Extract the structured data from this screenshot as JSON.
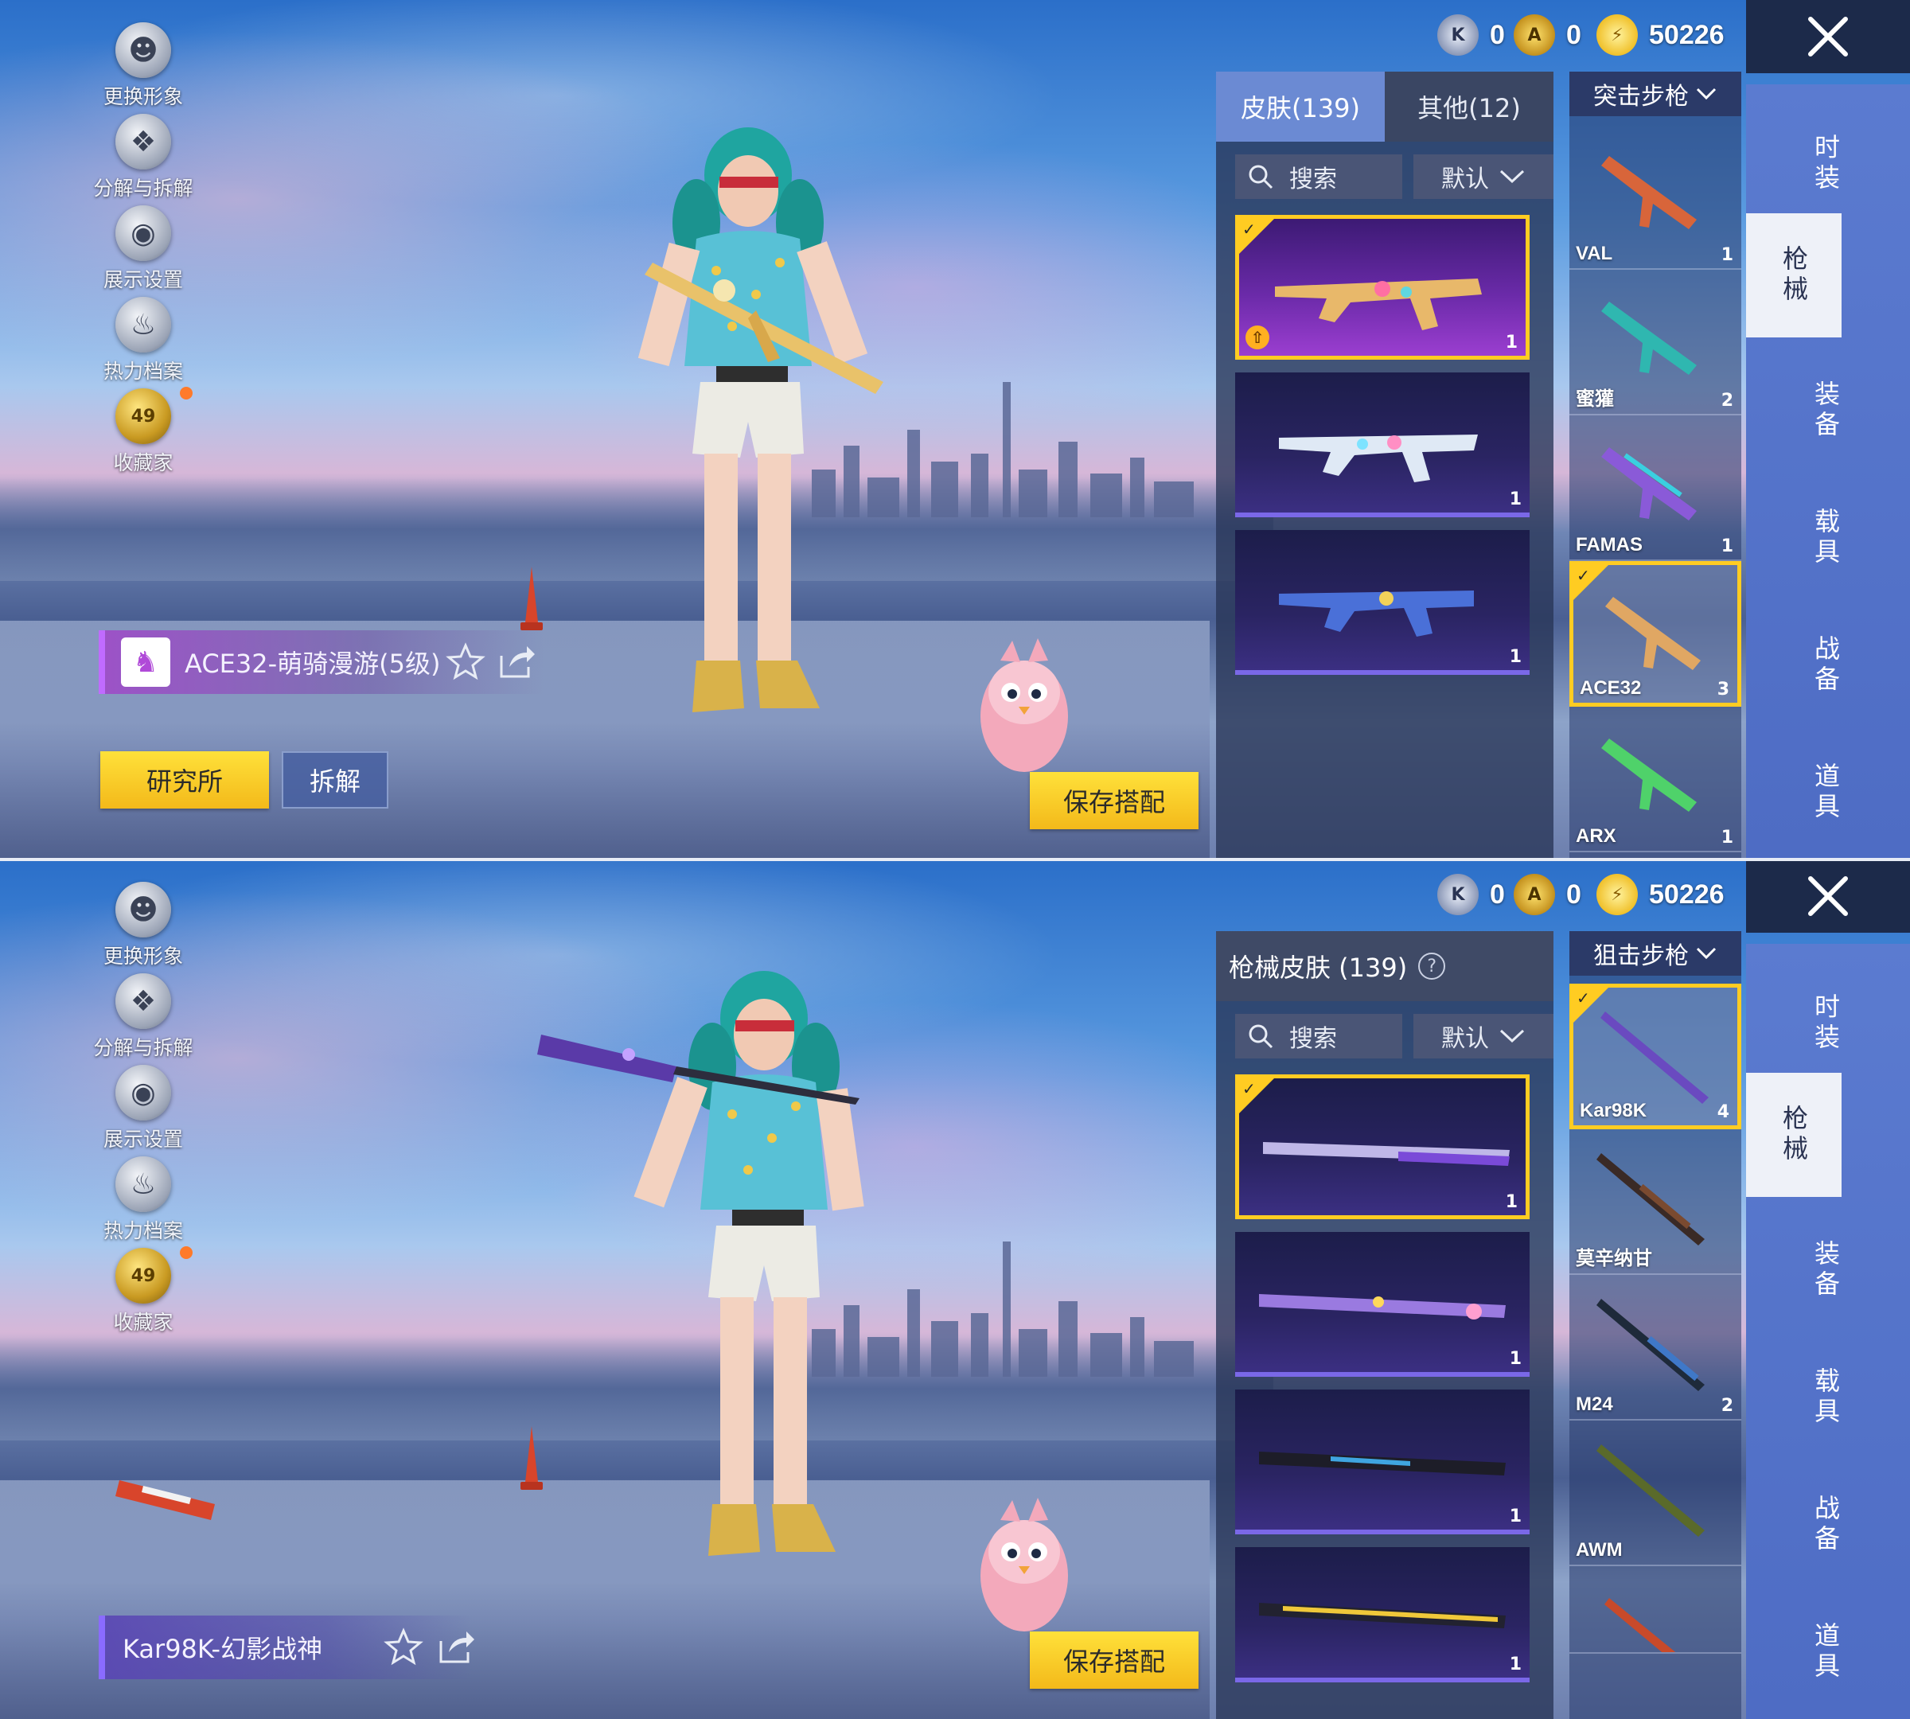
{
  "top": {
    "sidebar": [
      {
        "label": "更换形象"
      },
      {
        "label": "分解与拆解"
      },
      {
        "label": "展示设置"
      },
      {
        "label": "热力档案"
      },
      {
        "label": "收藏家",
        "badge": "49"
      }
    ],
    "currency": [
      {
        "icon": "medal-silver-icon",
        "value": "0"
      },
      {
        "icon": "medal-gold-icon",
        "value": "0"
      },
      {
        "icon": "coin-icon",
        "value": "50226"
      }
    ],
    "tabs": [
      {
        "label": "皮肤(139)",
        "active": true
      },
      {
        "label": "其他(12)",
        "active": false
      }
    ],
    "search_label": "搜索",
    "sort_label": "默认",
    "category": "突击步枪",
    "skins": [
      {
        "count": "1",
        "selected": true
      },
      {
        "count": "1",
        "selected": false
      },
      {
        "count": "1",
        "selected": false
      }
    ],
    "weapons": [
      {
        "name": "VAL",
        "count": "1",
        "selected": false
      },
      {
        "name": "蜜獾",
        "count": "2",
        "selected": false
      },
      {
        "name": "FAMAS",
        "count": "1",
        "selected": false
      },
      {
        "name": "ACE32",
        "count": "3",
        "selected": true
      },
      {
        "name": "ARX",
        "count": "1",
        "selected": false
      }
    ],
    "banner_name": "ACE32-萌骑漫游(5级)",
    "research_button": "研究所",
    "dismantle_button": "拆解",
    "save_button": "保存搭配"
  },
  "bottom": {
    "sidebar": [
      {
        "label": "更换形象"
      },
      {
        "label": "分解与拆解"
      },
      {
        "label": "展示设置"
      },
      {
        "label": "热力档案"
      },
      {
        "label": "收藏家",
        "badge": "49"
      }
    ],
    "currency": [
      {
        "icon": "medal-silver-icon",
        "value": "0"
      },
      {
        "icon": "medal-gold-icon",
        "value": "0"
      },
      {
        "icon": "coin-icon",
        "value": "50226"
      }
    ],
    "panel_title": "枪械皮肤 (139)",
    "search_label": "搜索",
    "sort_label": "默认",
    "category": "狙击步枪",
    "skins": [
      {
        "count": "1",
        "selected": true
      },
      {
        "count": "1",
        "selected": false
      },
      {
        "count": "1",
        "selected": false
      },
      {
        "count": "1",
        "selected": false
      }
    ],
    "weapons": [
      {
        "name": "Kar98K",
        "count": "4",
        "selected": true
      },
      {
        "name": "莫辛纳甘",
        "count": "",
        "selected": false
      },
      {
        "name": "M24",
        "count": "2",
        "selected": false
      },
      {
        "name": "AWM",
        "count": "",
        "selected": false
      },
      {
        "name": "",
        "count": "",
        "selected": false
      }
    ],
    "banner_name": "Kar98K-幻影战神",
    "save_button": "保存搭配"
  },
  "vnav": [
    {
      "label": "时装",
      "active": false
    },
    {
      "label": "枪械",
      "active": true
    },
    {
      "label": "装备",
      "active": false
    },
    {
      "label": "载具",
      "active": false
    },
    {
      "label": "战备",
      "active": false
    },
    {
      "label": "道具",
      "active": false
    }
  ],
  "colors": {
    "accent_yellow": "#ffcc22",
    "nav_blue": "#5b7bd0",
    "skin_purple": "#6a2aa8"
  }
}
